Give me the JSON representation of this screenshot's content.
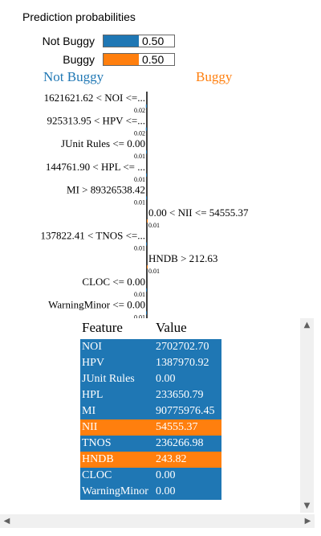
{
  "title": "Prediction probabilities",
  "probabilities": [
    {
      "label": "Not Buggy",
      "value": 0.5,
      "display": "0.50",
      "color": "#1f77b4"
    },
    {
      "label": "Buggy",
      "value": 0.5,
      "display": "0.50",
      "color": "#ff7f0e"
    }
  ],
  "class_headers": {
    "negative": "Not Buggy",
    "positive": "Buggy"
  },
  "chart_data": {
    "type": "bar",
    "orientation": "horizontal",
    "categories": [
      "1621621.62 < NOI <=...",
      "925313.95 < HPV <=...",
      "JUnit Rules <= 0.00",
      "144761.90 < HPL <= ...",
      "MI > 89326538.42",
      "0.00 < NII <= 54555.37",
      "137822.41 < TNOS <=...",
      "HNDB > 212.63",
      "CLOC <= 0.00",
      "WarningMinor <= 0.00"
    ],
    "values": [
      -0.02,
      -0.02,
      -0.01,
      -0.01,
      -0.01,
      0.01,
      -0.01,
      0.01,
      -0.01,
      -0.01
    ],
    "value_labels": [
      "0.02",
      "0.02",
      "0.01",
      "0.01",
      "0.01",
      "0.01",
      "0.01",
      "0.01",
      "0.01",
      "0.01"
    ],
    "colors": {
      "negative": "#1f77b4",
      "positive": "#ff7f0e"
    }
  },
  "feature_table": {
    "headers": [
      "Feature",
      "Value"
    ],
    "rows": [
      {
        "feature": "NOI",
        "value": "2702702.70",
        "class": "negative"
      },
      {
        "feature": "HPV",
        "value": "1387970.92",
        "class": "negative"
      },
      {
        "feature": "JUnit Rules",
        "value": "0.00",
        "class": "negative"
      },
      {
        "feature": "HPL",
        "value": "233650.79",
        "class": "negative"
      },
      {
        "feature": "MI",
        "value": "90775976.45",
        "class": "negative"
      },
      {
        "feature": "NII",
        "value": "54555.37",
        "class": "positive"
      },
      {
        "feature": "TNOS",
        "value": "236266.98",
        "class": "negative"
      },
      {
        "feature": "HNDB",
        "value": "243.82",
        "class": "positive"
      },
      {
        "feature": "CLOC",
        "value": "0.00",
        "class": "negative"
      },
      {
        "feature": "WarningMinor",
        "value": "0.00",
        "class": "negative"
      }
    ]
  },
  "scrollbars": {
    "up_icon": "arrow-up-icon",
    "down_icon": "arrow-down-icon",
    "left_icon": "arrow-left-icon",
    "right_icon": "arrow-right-icon"
  }
}
